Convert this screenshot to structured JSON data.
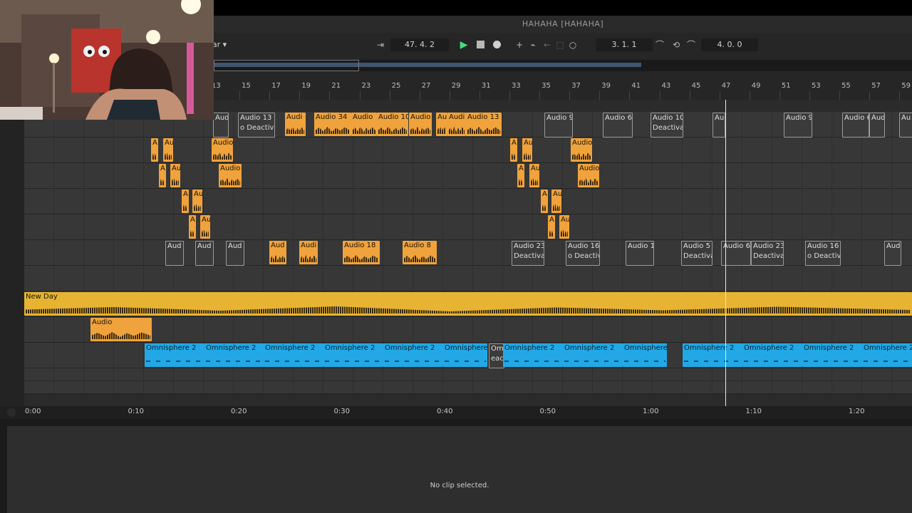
{
  "window": {
    "title": "HAHAHA  [HAHAHA]"
  },
  "transport": {
    "dropdown_partial": "ar",
    "arrangement_position": "47.   4.   2",
    "loop_start": "3.   1.   1",
    "loop_length": "4.   0.   0"
  },
  "ruler": {
    "bars": [
      "13",
      "15",
      "17",
      "19",
      "21",
      "23",
      "25",
      "27",
      "29",
      "31",
      "33",
      "35",
      "37",
      "39",
      "41",
      "43",
      "45",
      "47",
      "49",
      "51",
      "53",
      "55",
      "57",
      "59"
    ]
  },
  "tracks": [
    {
      "clips": [
        {
          "label": "Aud",
          "kind": "deact"
        },
        {
          "label": "Audio 13",
          "sub": "o Deactiva",
          "kind": "deact"
        },
        {
          "label": "Audi",
          "kind": "orange"
        },
        {
          "label": "Audio 34",
          "kind": "orange"
        },
        {
          "label": "Audio",
          "kind": "orange"
        },
        {
          "label": "Audio 10",
          "kind": "orange"
        },
        {
          "label": "Audio",
          "kind": "orange"
        },
        {
          "label": "Au",
          "kind": "orange"
        },
        {
          "label": "Audi",
          "kind": "orange"
        },
        {
          "label": "Audio 13",
          "kind": "orange"
        },
        {
          "label": "Audio 9",
          "kind": "deact"
        },
        {
          "label": "Audio 6",
          "kind": "deact"
        },
        {
          "label": "Audio 10",
          "sub": "Deactiva",
          "kind": "deact"
        },
        {
          "label": "Au",
          "kind": "deact"
        },
        {
          "label": "Audio 9",
          "kind": "deact"
        },
        {
          "label": "Audio 6",
          "kind": "deact"
        },
        {
          "label": "Aud",
          "kind": "deact"
        },
        {
          "label": "Au",
          "kind": "deact"
        }
      ]
    },
    {
      "clips": [
        {
          "label": "A",
          "kind": "orange"
        },
        {
          "label": "Au",
          "kind": "orange"
        },
        {
          "label": "Audio",
          "kind": "orange"
        },
        {
          "label": "A",
          "kind": "orange"
        },
        {
          "label": "Au",
          "kind": "orange"
        },
        {
          "label": "Audio",
          "kind": "orange"
        }
      ]
    },
    {
      "clips": [
        {
          "label": "A",
          "kind": "orange"
        },
        {
          "label": "Au",
          "kind": "orange"
        },
        {
          "label": "Audio",
          "kind": "orange"
        },
        {
          "label": "A",
          "kind": "orange"
        },
        {
          "label": "Au",
          "kind": "orange"
        },
        {
          "label": "Audio",
          "kind": "orange"
        }
      ]
    },
    {
      "clips": [
        {
          "label": "A",
          "kind": "orange"
        },
        {
          "label": "Au",
          "kind": "orange"
        },
        {
          "label": "A",
          "kind": "orange"
        },
        {
          "label": "Au",
          "kind": "orange"
        }
      ]
    },
    {
      "clips": [
        {
          "label": "A",
          "kind": "orange"
        },
        {
          "label": "Au",
          "kind": "orange"
        },
        {
          "label": "A",
          "kind": "orange"
        },
        {
          "label": "Au",
          "kind": "orange"
        }
      ]
    },
    {
      "clips": [
        {
          "label": "Aud",
          "kind": "deact"
        },
        {
          "label": "Aud",
          "kind": "deact"
        },
        {
          "label": "Aud",
          "kind": "deact"
        },
        {
          "label": "Aud",
          "kind": "orange"
        },
        {
          "label": "Audi",
          "kind": "orange"
        },
        {
          "label": "Audio 18",
          "kind": "orange"
        },
        {
          "label": "Audio 8",
          "kind": "orange"
        },
        {
          "label": "Audio 23",
          "sub": "Deactiva",
          "kind": "deact"
        },
        {
          "label": "Audio 16",
          "sub": "o Deactiva",
          "kind": "deact"
        },
        {
          "label": "Audio 1",
          "kind": "deact"
        },
        {
          "label": "Audio 5",
          "sub": "Deactiva",
          "kind": "deact"
        },
        {
          "label": "Audio 6",
          "kind": "deact"
        },
        {
          "label": "Audio 23",
          "sub": "Deactiva",
          "kind": "deact"
        },
        {
          "label": "Audio 16",
          "sub": "o Deactiva",
          "kind": "deact"
        },
        {
          "label": "Aud",
          "kind": "deact"
        }
      ]
    },
    {
      "clips": []
    },
    {
      "clips": [
        {
          "label": "New Day",
          "kind": "yellow"
        }
      ]
    },
    {
      "clips": [
        {
          "label": "Audio",
          "kind": "orange"
        }
      ]
    },
    {
      "clips": [
        {
          "label": "Omnisphere 2",
          "kind": "blue"
        },
        {
          "label": "Omnisphere 2",
          "kind": "blue"
        },
        {
          "label": "Omnisphere 2",
          "kind": "blue"
        },
        {
          "label": "Omnisphere 2",
          "kind": "blue"
        },
        {
          "label": "Omnisphere 2",
          "kind": "blue"
        },
        {
          "label": "Omnisphere",
          "kind": "blue"
        },
        {
          "label": "Om",
          "sub": "eact",
          "kind": "deact"
        },
        {
          "label": "Omnisphere 2",
          "kind": "blue"
        },
        {
          "label": "Omnisphere 2",
          "kind": "blue"
        },
        {
          "label": "Omnisphere",
          "kind": "blue"
        },
        {
          "label": "Omnisphere 2",
          "kind": "blue"
        },
        {
          "label": "Omnisphere 2",
          "kind": "blue"
        },
        {
          "label": "Omnisphere 2",
          "kind": "blue"
        },
        {
          "label": "Omnisphere 2",
          "kind": "blue"
        }
      ]
    },
    {
      "clips": []
    },
    {
      "clips": []
    }
  ],
  "timeline": {
    "labels": [
      "0:00",
      "0:10",
      "0:20",
      "0:30",
      "0:40",
      "0:50",
      "1:00",
      "1:10",
      "1:20"
    ]
  },
  "detail": {
    "message": "No clip selected."
  },
  "colors": {
    "audio_clip": "#f0a33c",
    "midi_clip": "#22a8e6",
    "new_day_clip": "#e6b432",
    "play_button": "#3ee07a"
  }
}
